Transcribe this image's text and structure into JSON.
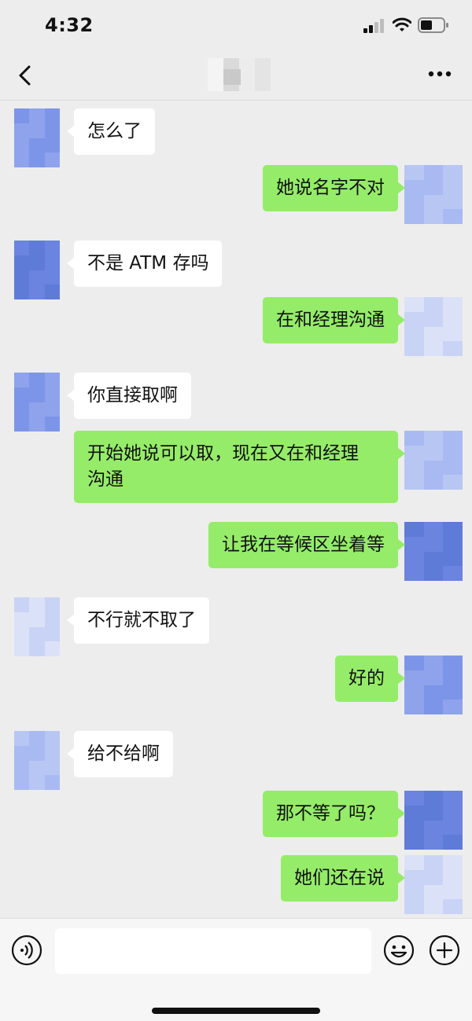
{
  "status_bar": {
    "time": "4:32",
    "icons": [
      "signal-icon",
      "wifi-icon",
      "battery-icon"
    ]
  },
  "nav": {
    "back_icon": "chevron-left-icon",
    "more_icon": "more-horizontal-icon"
  },
  "colors": {
    "background": "#ededed",
    "incoming_bubble": "#ffffff",
    "outgoing_bubble": "#95ec69",
    "text": "#111111"
  },
  "messages": [
    {
      "direction": "in",
      "text": "怎么了"
    },
    {
      "direction": "out",
      "text": "她说名字不对"
    },
    {
      "direction": "in",
      "text": "不是 ATM 存吗"
    },
    {
      "direction": "out",
      "text": "在和经理沟通"
    },
    {
      "direction": "in",
      "text": "你直接取啊"
    },
    {
      "direction": "out",
      "text": "开始她说可以取，现在又在和经理\n沟通"
    },
    {
      "direction": "out",
      "text": "让我在等候区坐着等"
    },
    {
      "direction": "in",
      "text": "不行就不取了"
    },
    {
      "direction": "out",
      "text": "好的"
    },
    {
      "direction": "in",
      "text": "给不给啊"
    },
    {
      "direction": "out",
      "text": "那不等了吗？"
    },
    {
      "direction": "out",
      "text": "她们还在说"
    }
  ],
  "input_bar": {
    "placeholder": "",
    "voice_icon": "voice-icon",
    "emoji_icon": "emoji-icon",
    "plus_icon": "plus-icon"
  }
}
